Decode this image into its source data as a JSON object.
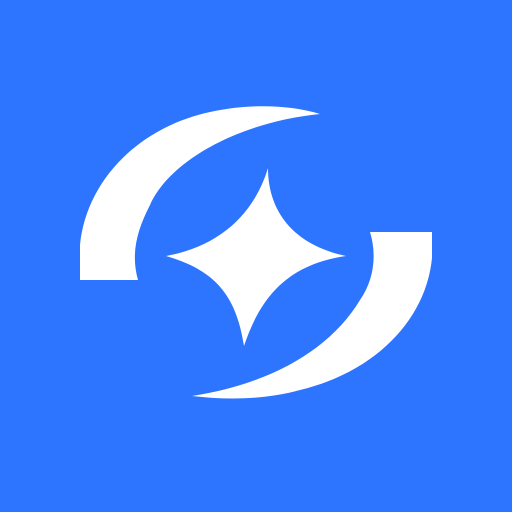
{
  "icon": {
    "name": "sparkle-orbit-logo",
    "background_color": "#2D74FF",
    "mark_color": "#FFFFFF",
    "elements": [
      "upper-left-crescent",
      "lower-right-crescent",
      "four-point-star"
    ]
  }
}
